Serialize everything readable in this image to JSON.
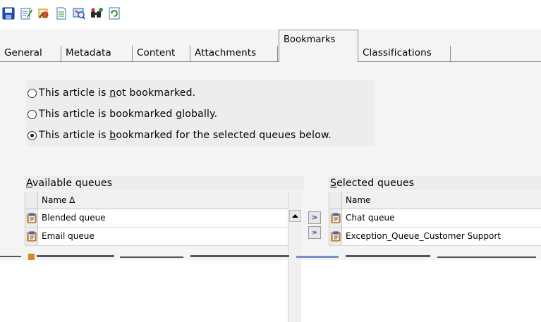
{
  "toolbar": {
    "icons": [
      {
        "name": "save-icon"
      },
      {
        "name": "edit-note-icon"
      },
      {
        "name": "edit-properties-icon"
      },
      {
        "name": "document-icon"
      },
      {
        "name": "preview-icon"
      },
      {
        "name": "find-icon"
      },
      {
        "name": "refresh-icon"
      }
    ]
  },
  "tabs": [
    {
      "label": "General"
    },
    {
      "label": "Metadata"
    },
    {
      "label": "Content"
    },
    {
      "label": "Attachments"
    },
    {
      "label": "Bookmarks"
    },
    {
      "label": "Classifications"
    }
  ],
  "bookmark_options": {
    "not_bookmarked": {
      "pre": "This article is ",
      "accel": "n",
      "post": "ot bookmarked."
    },
    "globally": {
      "pre": "This article is bookmarked ",
      "accel": "g",
      "post": "lobally."
    },
    "selected_queues": {
      "pre": "This article is ",
      "accel": "b",
      "post": "ookmarked for the selected queues below."
    }
  },
  "selected_option": "selected_queues",
  "available_queues": {
    "title_accel": "A",
    "title_rest": "vailable queues",
    "column_header": "Name ∆",
    "rows": [
      "Blended queue",
      "Email queue"
    ]
  },
  "selected_queues": {
    "title_accel": "S",
    "title_rest": "elected queues",
    "column_header": "Name",
    "rows": [
      "Chat queue",
      "Exception_Queue_Customer Support"
    ]
  },
  "move_buttons": {
    "move_one": ">",
    "move_all": "»"
  },
  "colors": {
    "toolbar_bg": "#ffffff",
    "panel_bg": "#f4f4f4",
    "group_bg": "#ededed",
    "accent_blue": "#2b4bb0",
    "clipboard_orange": "#d98a1e"
  }
}
